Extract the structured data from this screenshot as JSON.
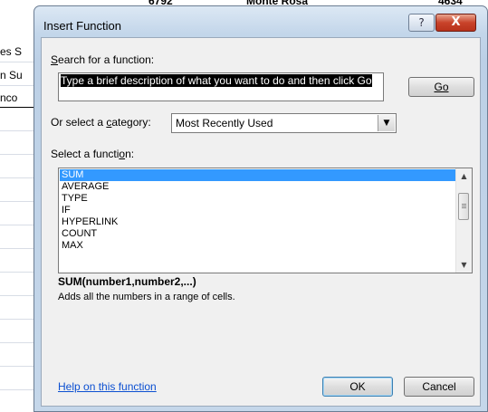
{
  "spreadsheet": {
    "top_cells": [
      "6792",
      "Monte Rosa",
      "4634"
    ],
    "left_cells": [
      "es S",
      "n Su",
      "nco"
    ]
  },
  "dialog": {
    "title": "Insert Function",
    "help_button": "?",
    "close_button": "X",
    "search_label": "Search for a function:",
    "search_value": "Type a brief description of what you want to do and then click Go",
    "go_button": "Go",
    "category_label": "Or select a category:",
    "category_value": "Most Recently Used",
    "function_label": "Select a function:",
    "functions": [
      "SUM",
      "AVERAGE",
      "TYPE",
      "IF",
      "HYPERLINK",
      "COUNT",
      "MAX"
    ],
    "selected_function": "SUM",
    "signature": "SUM(number1,number2,...)",
    "description": "Adds all the numbers in a range of cells.",
    "help_link": "Help on this function",
    "ok_button": "OK",
    "cancel_button": "Cancel"
  }
}
